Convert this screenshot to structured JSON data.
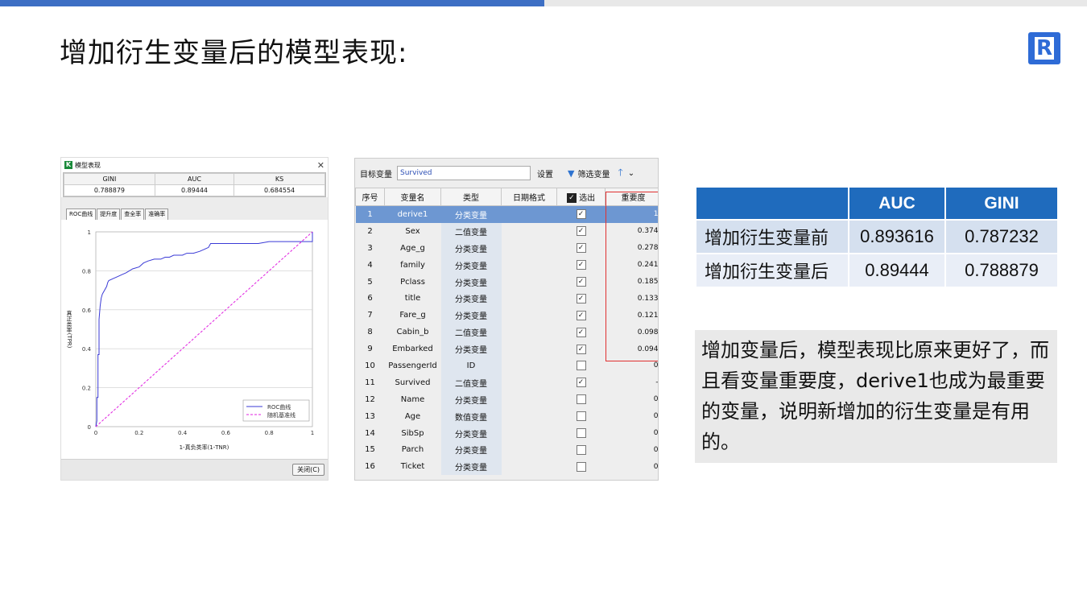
{
  "slide": {
    "title": "增加衍生变量后的模型表现:",
    "logo_letter": "R"
  },
  "dialog": {
    "window_title": "模型表现",
    "metrics_headers": [
      "GINI",
      "AUC",
      "KS"
    ],
    "metrics_values": [
      "0.788879",
      "0.89444",
      "0.684554"
    ],
    "tabs": [
      "ROC曲线",
      "提升度",
      "查全率",
      "准确率"
    ],
    "active_tab": "ROC曲线",
    "close_button": "关闭(C)"
  },
  "chart_data": {
    "type": "line",
    "xlabel": "1-真负类率(1-TNR)",
    "ylabel": "真正类率(TPR)",
    "xlim": [
      0,
      1
    ],
    "ylim": [
      0,
      1
    ],
    "x_ticks": [
      "0",
      "0.2",
      "0.4",
      "0.6",
      "0.8",
      "1"
    ],
    "y_ticks": [
      "0",
      "0.2",
      "0.4",
      "0.6",
      "0.8",
      "1"
    ],
    "grid": "horizontal",
    "legend_position": "bottom-right",
    "series": [
      {
        "name": "ROC曲线",
        "color": "#3a3ad6",
        "style": "solid",
        "points": [
          [
            0,
            0
          ],
          [
            0.005,
            0.03
          ],
          [
            0.005,
            0.15
          ],
          [
            0.01,
            0.15
          ],
          [
            0.01,
            0.37
          ],
          [
            0.015,
            0.37
          ],
          [
            0.015,
            0.55
          ],
          [
            0.02,
            0.62
          ],
          [
            0.025,
            0.66
          ],
          [
            0.03,
            0.68
          ],
          [
            0.04,
            0.7
          ],
          [
            0.05,
            0.72
          ],
          [
            0.055,
            0.74
          ],
          [
            0.06,
            0.75
          ],
          [
            0.08,
            0.76
          ],
          [
            0.1,
            0.77
          ],
          [
            0.12,
            0.78
          ],
          [
            0.14,
            0.79
          ],
          [
            0.17,
            0.81
          ],
          [
            0.2,
            0.82
          ],
          [
            0.22,
            0.84
          ],
          [
            0.24,
            0.85
          ],
          [
            0.27,
            0.86
          ],
          [
            0.3,
            0.86
          ],
          [
            0.32,
            0.87
          ],
          [
            0.34,
            0.87
          ],
          [
            0.36,
            0.88
          ],
          [
            0.4,
            0.88
          ],
          [
            0.42,
            0.89
          ],
          [
            0.45,
            0.89
          ],
          [
            0.48,
            0.9
          ],
          [
            0.5,
            0.91
          ],
          [
            0.52,
            0.92
          ],
          [
            0.53,
            0.94
          ],
          [
            0.75,
            0.94
          ],
          [
            0.8,
            0.95
          ],
          [
            1,
            0.95
          ],
          [
            1,
            1
          ]
        ]
      },
      {
        "name": "随机基准线",
        "color": "#e020e0",
        "style": "dashed",
        "points": [
          [
            0,
            0
          ],
          [
            1,
            1
          ]
        ]
      }
    ]
  },
  "var_panel": {
    "target_label": "目标变量",
    "target_value": "Survived",
    "settings_label": "设置",
    "filter_label": "筛选变量",
    "up_icon": "arrow-up-icon",
    "columns": [
      "序号",
      "变量名",
      "类型",
      "日期格式",
      "选出",
      "重要度"
    ],
    "rows": [
      {
        "no": "1",
        "name": "derive1",
        "type": "分类变量",
        "checked": true,
        "importance": "1",
        "selected": true
      },
      {
        "no": "2",
        "name": "Sex",
        "type": "二值变量",
        "checked": true,
        "importance": "0.374"
      },
      {
        "no": "3",
        "name": "Age_g",
        "type": "分类变量",
        "checked": true,
        "importance": "0.278"
      },
      {
        "no": "4",
        "name": "family",
        "type": "分类变量",
        "checked": true,
        "importance": "0.241"
      },
      {
        "no": "5",
        "name": "Pclass",
        "type": "分类变量",
        "checked": true,
        "importance": "0.185"
      },
      {
        "no": "6",
        "name": "title",
        "type": "分类变量",
        "checked": true,
        "importance": "0.133"
      },
      {
        "no": "7",
        "name": "Fare_g",
        "type": "分类变量",
        "checked": true,
        "importance": "0.121"
      },
      {
        "no": "8",
        "name": "Cabin_b",
        "type": "二值变量",
        "checked": true,
        "importance": "0.098"
      },
      {
        "no": "9",
        "name": "Embarked",
        "type": "分类变量",
        "checked": true,
        "importance": "0.094"
      },
      {
        "no": "10",
        "name": "PassengerId",
        "type": "ID",
        "checked": false,
        "importance": "0"
      },
      {
        "no": "11",
        "name": "Survived",
        "type": "二值变量",
        "checked": true,
        "importance": "-"
      },
      {
        "no": "12",
        "name": "Name",
        "type": "分类变量",
        "checked": false,
        "importance": "0"
      },
      {
        "no": "13",
        "name": "Age",
        "type": "数值变量",
        "checked": false,
        "importance": "0"
      },
      {
        "no": "14",
        "name": "SibSp",
        "type": "分类变量",
        "checked": false,
        "importance": "0"
      },
      {
        "no": "15",
        "name": "Parch",
        "type": "分类变量",
        "checked": false,
        "importance": "0"
      },
      {
        "no": "16",
        "name": "Ticket",
        "type": "分类变量",
        "checked": false,
        "importance": "0"
      }
    ]
  },
  "comparison": {
    "headers": [
      "",
      "AUC",
      "GINI"
    ],
    "rows": [
      {
        "label": "增加衍生变量前",
        "auc": "0.893616",
        "gini": "0.787232"
      },
      {
        "label": "增加衍生变量后",
        "auc": "0.89444",
        "gini": "0.788879"
      }
    ]
  },
  "note": {
    "text": "增加变量后，模型表现比原来更好了，而且看变量重要度，derive1也成为最重要的变量，说明新增加的衍生变量是有用的。"
  },
  "colors": {
    "accent_blue": "#3d6fc4",
    "table_header": "#1f6bbd",
    "selected_row": "#6d97d2",
    "highlight_box": "#e03030"
  }
}
